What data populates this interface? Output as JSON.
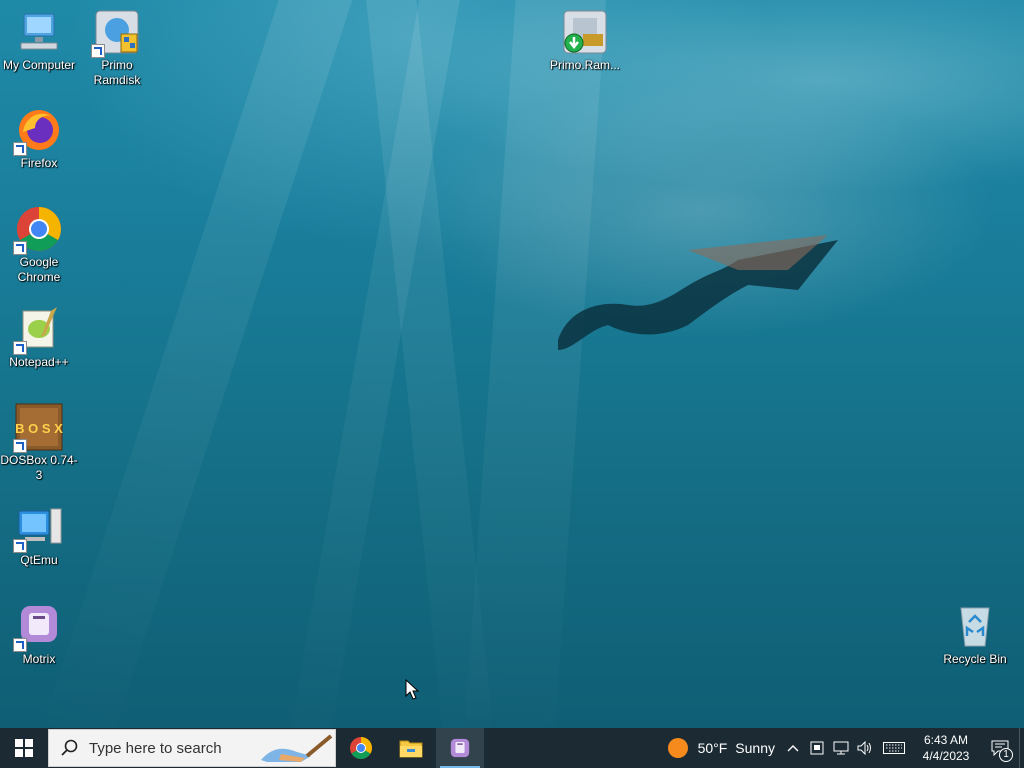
{
  "desktop": {
    "icons_left": [
      {
        "id": "my-computer",
        "label": "My Computer",
        "icon": "computer-icon",
        "shortcut": false
      },
      {
        "id": "firefox",
        "label": "Firefox",
        "icon": "firefox-icon",
        "shortcut": true
      },
      {
        "id": "google-chrome",
        "label": "Google Chrome",
        "icon": "chrome-icon",
        "shortcut": true
      },
      {
        "id": "notepad-plus-plus",
        "label": "Notepad++",
        "icon": "notepad-plus-plus-icon",
        "shortcut": true
      },
      {
        "id": "dosbox",
        "label": "DOSBox 0.74-3",
        "icon": "dosbox-icon",
        "shortcut": true
      },
      {
        "id": "qtemu",
        "label": "QtEmu",
        "icon": "qtemu-icon",
        "shortcut": true
      },
      {
        "id": "motrix",
        "label": "Motrix",
        "icon": "motrix-icon",
        "shortcut": true
      }
    ],
    "primo_ramdisk": {
      "label": "Primo Ramdisk",
      "icon": "primo-ramdisk-icon",
      "shortcut": true
    },
    "primo_ram_file": {
      "label": "Primo.Ram...",
      "icon": "primo-ram-file-icon",
      "shortcut": false
    },
    "recycle_bin": {
      "label": "Recycle Bin",
      "icon": "recycle-bin-icon"
    },
    "dosbox_glyph_text": "B O S X"
  },
  "taskbar": {
    "start_icon": "windows-start-icon",
    "search_placeholder": "Type here to search",
    "pinned": [
      {
        "name": "Google Chrome",
        "icon": "chrome-icon"
      },
      {
        "name": "File Explorer",
        "icon": "file-explorer-icon"
      },
      {
        "name": "Motrix",
        "icon": "motrix-icon",
        "active": true
      }
    ],
    "weather": {
      "temp": "50°F",
      "condition": "Sunny"
    },
    "clock": {
      "time": "6:43 AM",
      "date": "4/4/2023"
    },
    "notification_count": "1"
  },
  "colors": {
    "taskbar_bg": "#1b2a33",
    "active_indicator": "#76b9ed",
    "water_top": "#1f8aa8",
    "water_bottom": "#0f5e74"
  }
}
